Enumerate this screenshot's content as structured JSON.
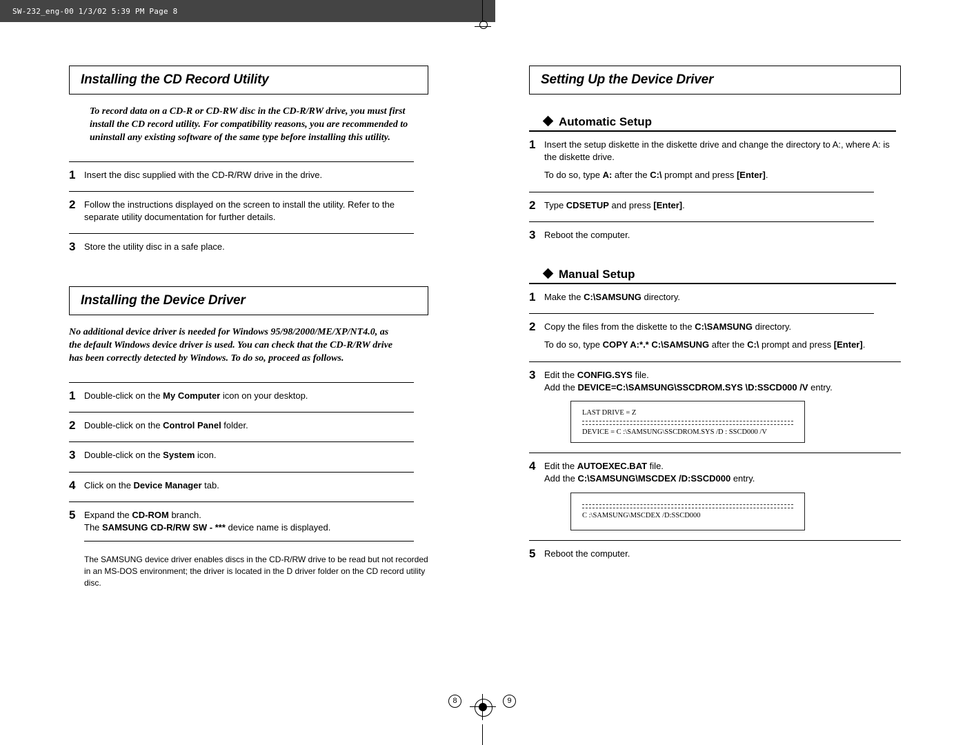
{
  "header": {
    "slug": "SW-232_eng-00  1/3/02 5:39 PM  Page 8"
  },
  "left": {
    "sec1_title": "Installing the CD Record Utility",
    "sec1_intro": "To record data on a CD-R or CD-RW disc in the CD-R/RW drive, you must first install the CD record utility. For compatibility reasons, you are recommended to uninstall any existing software of the same type before installing this utility.",
    "sec1_steps": {
      "s1": "Insert the disc supplied with the CD-R/RW drive in the drive.",
      "s2": "Follow the instructions displayed on the screen to install the utility. Refer to the separate utility documentation for further details.",
      "s3": "Store the utility disc in a safe place."
    },
    "sec2_title": "Installing the Device Driver",
    "sec2_intro": "No additional device driver is needed for Windows 95/98/2000/ME/XP/NT4.0, as the default Windows device driver is used. You can check that the CD-R/RW drive has been correctly detected by Windows. To do so, proceed as follows.",
    "sec2_steps": {
      "s1_pre": "Double-click on the ",
      "s1_bold": "My Computer",
      "s1_post": " icon on your desktop.",
      "s2_pre": "Double-click on the ",
      "s2_bold": "Control Panel",
      "s2_post": " folder.",
      "s3_pre": "Double-click on the ",
      "s3_bold": "System",
      "s3_post": " icon.",
      "s4_pre": "Click on the ",
      "s4_bold": "Device Manager",
      "s4_post": " tab.",
      "s5a_pre": "Expand the ",
      "s5a_bold": "CD-ROM",
      "s5a_post": " branch.",
      "s5b_pre": "The ",
      "s5b_bold": "SAMSUNG CD-R/RW SW - ***",
      "s5b_post": " device name is displayed."
    },
    "sec2_note": "The SAMSUNG device driver enables discs in the CD-R/RW drive to be read but not recorded in an MS-DOS environment; the driver is located in the D driver folder on the CD record utility disc.",
    "page_no": "8"
  },
  "right": {
    "title": "Setting Up the Device Driver",
    "auto_h": "Automatic Setup",
    "auto": {
      "s1": "Insert the setup diskette in the diskette drive and change the directory to A:, where A: is the diskette drive.",
      "s1_ind_pre": "To do so, type ",
      "s1_ind_b1": "A:",
      "s1_ind_mid1": " after the ",
      "s1_ind_b2": "C:\\",
      "s1_ind_mid2": " prompt and press ",
      "s1_ind_b3": "[Enter]",
      "s1_ind_post": ".",
      "s2_pre": "Type ",
      "s2_bold": "CDSETUP",
      "s2_mid": " and press ",
      "s2_bold2": "[Enter]",
      "s2_post": ".",
      "s3": "Reboot the computer."
    },
    "man_h": "Manual Setup",
    "man": {
      "s1_pre": "Make the ",
      "s1_bold": "C:\\SAMSUNG",
      "s1_post": " directory.",
      "s2_pre": "Copy the files from the diskette to the ",
      "s2_bold": "C:\\SAMSUNG",
      "s2_post": " directory.",
      "s2_ind_pre": "To do so, type ",
      "s2_ind_b1": "COPY A:*.* C:\\SAMSUNG",
      "s2_ind_mid1": " after the ",
      "s2_ind_b2": "C:\\",
      "s2_ind_mid2": " prompt and press ",
      "s2_ind_b3": "[Enter]",
      "s2_ind_post": ".",
      "s3_pre": "Edit the ",
      "s3_bold": "CONFIG.SYS",
      "s3_post": " file.",
      "s3b_pre": "Add the ",
      "s3b_bold": "DEVICE=C:\\SAMSUNG\\SSCDROM.SYS \\D:SSCD000 /V",
      "s3b_post": " entry.",
      "code1_l1": "LAST DRIVE = Z",
      "code1_l2": "DEVICE = C :\\SAMSUNG\\SSCDROM.SYS  /D : SSCD000  /V",
      "s4_pre": "Edit the ",
      "s4_bold": "AUTOEXEC.BAT",
      "s4_post": " file.",
      "s4b_pre": "Add the ",
      "s4b_bold": "C:\\SAMSUNG\\MSCDEX /D:SSCD000",
      "s4b_post": " entry.",
      "code2_l1": "C :\\SAMSUNG\\MSCDEX  /D:SSCD000",
      "s5": "Reboot the computer."
    },
    "page_no": "9"
  }
}
